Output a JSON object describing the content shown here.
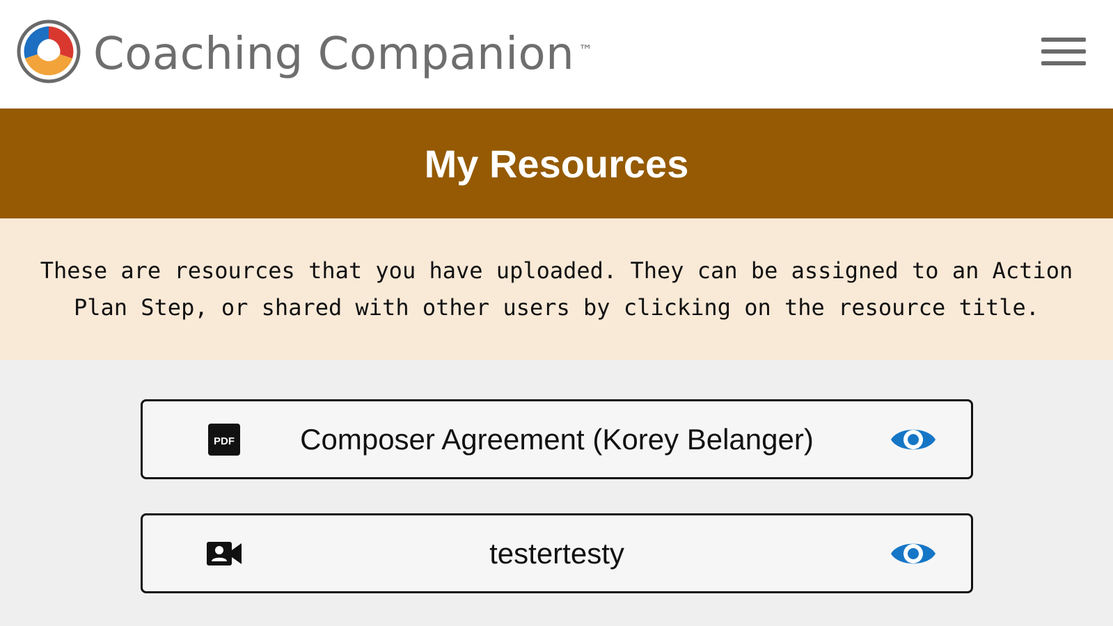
{
  "header": {
    "brand_name": "Coaching Companion",
    "trademark": "™",
    "logo_icon": "coaching-companion-logo",
    "menu_icon": "hamburger-menu-icon"
  },
  "page": {
    "title": "My Resources",
    "description": "These are resources that you have uploaded. They can be assigned to an Action Plan Step, or shared with other users by clicking on the resource title."
  },
  "resources": [
    {
      "title": "Composer Agreement (Korey Belanger)",
      "type_icon": "pdf-icon",
      "view_icon": "eye-icon"
    },
    {
      "title": "testertesty",
      "type_icon": "video-camera-icon",
      "view_icon": "eye-icon"
    }
  ],
  "colors": {
    "header_bg": "#ffffff",
    "title_band": "#955a03",
    "info_band": "#f9e9d7",
    "page_bg": "#efefef",
    "eye_blue": "#1676c6"
  }
}
